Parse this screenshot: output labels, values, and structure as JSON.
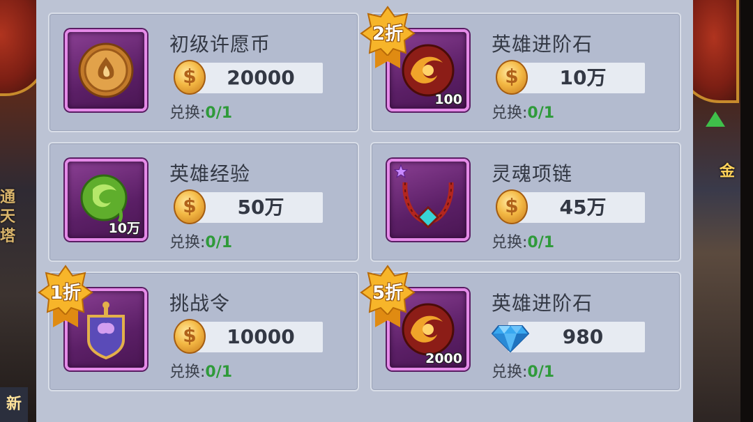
{
  "side": {
    "left_text": "通天塔",
    "left_bottom_tab": "新",
    "right_text": "金"
  },
  "exchange_label": "兑换:",
  "cards": [
    {
      "name": "初级许愿币",
      "price": "20000",
      "currency": "coin-icon",
      "count": "",
      "exchange": "0/1",
      "discount": "",
      "item_icon": "wish-coin-icon",
      "accent": "#d8963a"
    },
    {
      "name": "英雄进阶石",
      "price": "10万",
      "currency": "coin-icon",
      "count": "100",
      "exchange": "0/1",
      "discount": "2折",
      "item_icon": "advance-stone-icon",
      "accent": "#b52a1e"
    },
    {
      "name": "英雄经验",
      "price": "50万",
      "currency": "coin-icon",
      "count": "10万",
      "exchange": "0/1",
      "discount": "",
      "item_icon": "exp-orb-icon",
      "accent": "#6cc03a"
    },
    {
      "name": "灵魂项链",
      "price": "45万",
      "currency": "coin-icon",
      "count": "",
      "exchange": "0/1",
      "discount": "",
      "item_icon": "soul-necklace-icon",
      "accent": "#c0322a"
    },
    {
      "name": "挑战令",
      "price": "10000",
      "currency": "coin-icon",
      "count": "",
      "exchange": "0/1",
      "discount": "1折",
      "item_icon": "challenge-token-icon",
      "accent": "#8a5ad8"
    },
    {
      "name": "英雄进阶石",
      "price": "980",
      "currency": "diamond-icon",
      "count": "2000",
      "exchange": "0/1",
      "discount": "5折",
      "item_icon": "advance-stone-icon",
      "accent": "#b52a1e"
    }
  ],
  "colors": {
    "panel": "#bcc3d4",
    "card": "#b3bbcf",
    "exchange_count": "#2f9a3a",
    "badge": "#f7b52a"
  }
}
